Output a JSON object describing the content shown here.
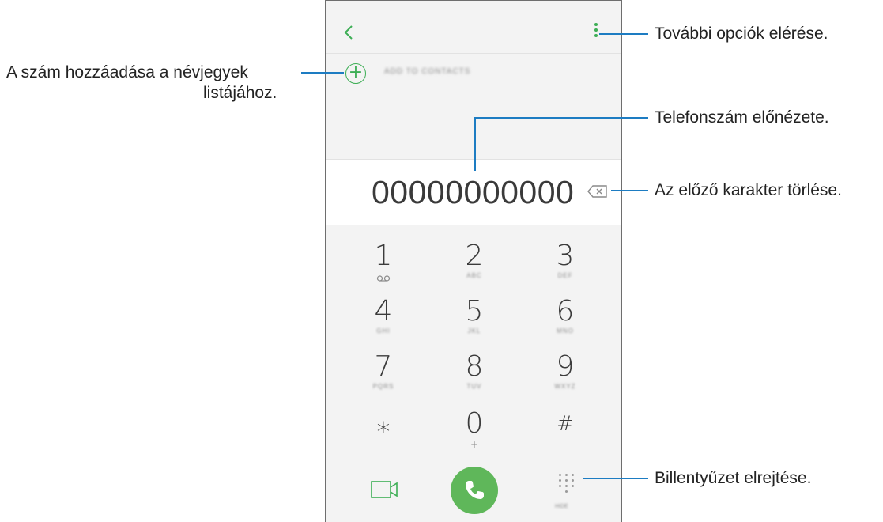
{
  "header": {
    "back_icon": "chevron-left-icon",
    "more_icon": "kebab-menu-icon"
  },
  "add_to_contacts": {
    "label": "ADD TO CONTACTS",
    "icon": "plus-circle-icon"
  },
  "dialed_number": "00000000000",
  "backspace_icon": "backspace-icon",
  "keypad": [
    {
      "digit": "1",
      "sub": "voicemail-icon",
      "sub_text": ""
    },
    {
      "digit": "2",
      "sub_text": "ABC"
    },
    {
      "digit": "3",
      "sub_text": "DEF"
    },
    {
      "digit": "4",
      "sub_text": "GHI"
    },
    {
      "digit": "5",
      "sub_text": "JKL"
    },
    {
      "digit": "6",
      "sub_text": "MNO"
    },
    {
      "digit": "7",
      "sub_text": "PQRS"
    },
    {
      "digit": "8",
      "sub_text": "TUV"
    },
    {
      "digit": "9",
      "sub_text": "WXYZ"
    },
    {
      "digit": "⁎",
      "sub_text": ""
    },
    {
      "digit": "0",
      "sub_text": "+"
    },
    {
      "digit": "#",
      "sub_text": ""
    }
  ],
  "bottom": {
    "video_icon": "video-call-icon",
    "call_icon": "phone-icon",
    "keypad_icon": "dialpad-icon",
    "keypad_label": "HIDE"
  },
  "callouts": {
    "more_options": "További opciók elérése.",
    "add_number_line1": "A szám hozzáadása a névjegyek",
    "add_number_line2": "listájához.",
    "preview": "Telefonszám előnézete.",
    "delete_char": "Az előző karakter törlése.",
    "hide_keypad": "Billentyűzet elrejtése."
  },
  "colors": {
    "accent": "#3dae55",
    "call_button": "#5fb75a",
    "callout_line": "#1d7cc2"
  }
}
